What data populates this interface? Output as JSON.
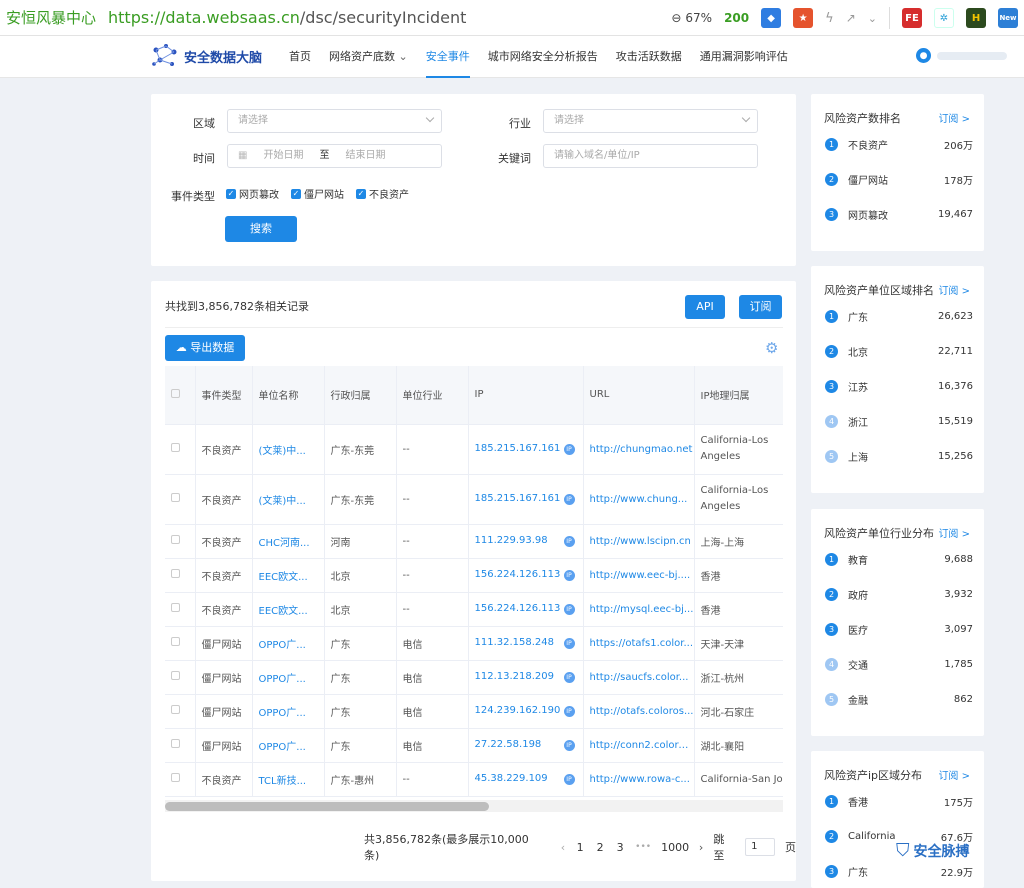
{
  "browser": {
    "title": "安恒风暴中心",
    "url_host": "https://data.websaas.cn",
    "url_path": "/dsc/securityIncident",
    "zoom": "67%",
    "status": "200"
  },
  "nav": {
    "logo": "安全数据大脑",
    "items": [
      {
        "label": "首页"
      },
      {
        "label": "网络资产底数"
      },
      {
        "label": "安全事件"
      },
      {
        "label": "城市网络安全分析报告"
      },
      {
        "label": "攻击活跃数据"
      },
      {
        "label": "通用漏洞影响评估"
      }
    ]
  },
  "filter": {
    "region_label": "区域",
    "region_placeholder": "请选择",
    "industry_label": "行业",
    "industry_placeholder": "请选择",
    "time_label": "时间",
    "start_placeholder": "开始日期",
    "to": "至",
    "end_placeholder": "结束日期",
    "keyword_label": "关键词",
    "keyword_placeholder": "请输入域名/单位/IP",
    "type_label": "事件类型",
    "types": [
      "网页篡改",
      "僵尸网站",
      "不良资产"
    ],
    "search": "搜索"
  },
  "results": {
    "count_text": "共找到3,856,782条相关记录",
    "api": "API",
    "subscribe": "订阅",
    "export": "导出数据",
    "columns": [
      "事件类型",
      "单位名称",
      "行政归属",
      "单位行业",
      "IP",
      "URL",
      "IP地理归属"
    ],
    "rows": [
      {
        "type": "不良资产",
        "unit": "(文莱)中...",
        "region": "广东-东莞",
        "industry": "--",
        "ip": "185.215.167.161",
        "url": "http://chungmao.net",
        "geo": "California-Los Angeles"
      },
      {
        "type": "不良资产",
        "unit": "(文莱)中...",
        "region": "广东-东莞",
        "industry": "--",
        "ip": "185.215.167.161",
        "url": "http://www.chung...",
        "geo": "California-Los Angeles"
      },
      {
        "type": "不良资产",
        "unit": "CHC河南...",
        "region": "河南",
        "industry": "--",
        "ip": "111.229.93.98",
        "url": "http://www.lscipn.cn",
        "geo": "上海-上海"
      },
      {
        "type": "不良资产",
        "unit": "EEC欧文...",
        "region": "北京",
        "industry": "--",
        "ip": "156.224.126.113",
        "url": "http://www.eec-bj....",
        "geo": "香港"
      },
      {
        "type": "不良资产",
        "unit": "EEC欧文...",
        "region": "北京",
        "industry": "--",
        "ip": "156.224.126.113",
        "url": "http://mysql.eec-bj...",
        "geo": "香港"
      },
      {
        "type": "僵尸网站",
        "unit": "OPPO广...",
        "region": "广东",
        "industry": "电信",
        "ip": "111.32.158.248",
        "url": "https://otafs1.color...",
        "geo": "天津-天津"
      },
      {
        "type": "僵尸网站",
        "unit": "OPPO广...",
        "region": "广东",
        "industry": "电信",
        "ip": "112.13.218.209",
        "url": "http://saucfs.color...",
        "geo": "浙江-杭州"
      },
      {
        "type": "僵尸网站",
        "unit": "OPPO广...",
        "region": "广东",
        "industry": "电信",
        "ip": "124.239.162.190",
        "url": "http://otafs.coloros...",
        "geo": "河北-石家庄"
      },
      {
        "type": "僵尸网站",
        "unit": "OPPO广...",
        "region": "广东",
        "industry": "电信",
        "ip": "27.22.58.198",
        "url": "http://conn2.coloro...",
        "geo": "湖北-襄阳"
      },
      {
        "type": "不良资产",
        "unit": "TCL新技...",
        "region": "广东-惠州",
        "industry": "--",
        "ip": "45.38.229.109",
        "url": "http://www.rowa-c...",
        "geo": "California-San Jose"
      }
    ],
    "pager": {
      "total": "共3,856,782条(最多展示10,000条)",
      "pages": [
        "1",
        "2",
        "3"
      ],
      "ellipsis": "•••",
      "last": "1000",
      "goto": "跳至",
      "input": "1",
      "page": "页"
    }
  },
  "side": [
    {
      "title": "风险资产数排名",
      "sub": "订阅 >",
      "items": [
        {
          "n": "1",
          "name": "不良资产",
          "value": "206万"
        },
        {
          "n": "2",
          "name": "僵尸网站",
          "value": "178万"
        },
        {
          "n": "3",
          "name": "网页篡改",
          "value": "19,467"
        }
      ]
    },
    {
      "title": "风险资产单位区域排名",
      "sub": "订阅 >",
      "items": [
        {
          "n": "1",
          "name": "广东",
          "value": "26,623"
        },
        {
          "n": "2",
          "name": "北京",
          "value": "22,711"
        },
        {
          "n": "3",
          "name": "江苏",
          "value": "16,376"
        },
        {
          "n": "4",
          "name": "浙江",
          "value": "15,519"
        },
        {
          "n": "5",
          "name": "上海",
          "value": "15,256"
        }
      ]
    },
    {
      "title": "风险资产单位行业分布",
      "sub": "订阅 >",
      "items": [
        {
          "n": "1",
          "name": "教育",
          "value": "9,688"
        },
        {
          "n": "2",
          "name": "政府",
          "value": "3,932"
        },
        {
          "n": "3",
          "name": "医疗",
          "value": "3,097"
        },
        {
          "n": "4",
          "name": "交通",
          "value": "1,785"
        },
        {
          "n": "5",
          "name": "金融",
          "value": "862"
        }
      ]
    },
    {
      "title": "风险资产ip区域分布",
      "sub": "订阅 >",
      "items": [
        {
          "n": "1",
          "name": "香港",
          "value": "175万"
        },
        {
          "n": "2",
          "name": "California",
          "value": "67.6万"
        },
        {
          "n": "3",
          "name": "广东",
          "value": "22.9万"
        }
      ]
    }
  ],
  "watermark": "安全脉搏"
}
